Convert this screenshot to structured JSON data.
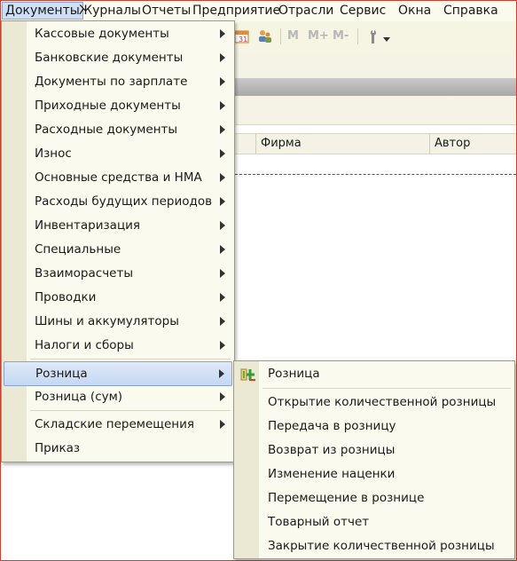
{
  "menubar": {
    "items": [
      "Документы",
      "Журналы",
      "Отчеты",
      "Предприятие",
      "Отрасли",
      "Сервис",
      "Окна",
      "Справка"
    ]
  },
  "toolbar": {
    "m_labels": [
      "M",
      "M+",
      "M-"
    ]
  },
  "table": {
    "columns": [
      "Фирма",
      "Автор"
    ]
  },
  "documents_menu": {
    "items": [
      "Кассовые документы",
      "Банковские документы",
      "Документы по зарплате",
      "Приходные документы",
      "Расходные документы",
      "Износ",
      "Основные средства и НМА",
      "Расходы будущих периодов",
      "Инвентаризация",
      "Специальные",
      "Взаиморасчеты",
      "Проводки",
      "Шины и аккумуляторы",
      "Налоги и сборы",
      "Розница",
      "Розница (сум)",
      "Складские перемещения",
      "Приказ"
    ],
    "highlighted": "Розница"
  },
  "retail_submenu": {
    "items": [
      "Розница",
      "Открытие количественной розницы",
      "Передача в розницу",
      "Возврат из розницы",
      "Изменение наценки",
      "Перемещение в рознице",
      "Товарный отчет",
      "Закрытие количественной розницы"
    ]
  },
  "icons": [
    "calendar-icon",
    "users-icon",
    "wrench-icon",
    "dropdown-arrow-icon",
    "retail-document-icon",
    "submenu-arrow-icon"
  ]
}
